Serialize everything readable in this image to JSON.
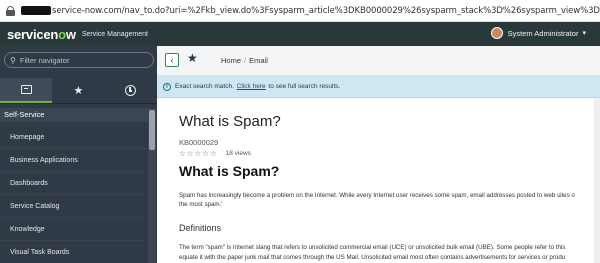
{
  "browser": {
    "url": "service-now.com/nav_to.do?uri=%2Fkb_view.do%3Fsysparm_article%3DKB0000029%26sysparm_stack%3D%26sysparm_view%3D"
  },
  "header": {
    "logo_main": "servicen",
    "logo_o": "o",
    "logo_end": "w",
    "subtitle": "Service Management",
    "user_name": "System Administrator",
    "user_caret": "▾"
  },
  "sidebar": {
    "filter_placeholder": "Filter navigator",
    "section_title": "Self-Service",
    "items": [
      {
        "label": "Homepage"
      },
      {
        "label": "Business Applications"
      },
      {
        "label": "Dashboards"
      },
      {
        "label": "Service Catalog"
      },
      {
        "label": "Knowledge"
      },
      {
        "label": "Visual Task Boards"
      }
    ],
    "tabs": [
      {
        "icon": "all-applications-icon"
      },
      {
        "icon": "favorites-star-icon"
      },
      {
        "icon": "history-clock-icon"
      }
    ]
  },
  "breadcrumbs": {
    "home": "Home",
    "separator": "/",
    "current": "Email"
  },
  "info": {
    "prefix": "Exact search match.",
    "link": "Click here",
    "suffix": "to see full search results."
  },
  "article": {
    "title": "What is Spam?",
    "number": "KB0000029",
    "stars": "☆☆☆☆☆",
    "views": "18 views",
    "heading": "What is Spam?",
    "para1_line1": "Spam has increasingly become a problem on the Internet. While every Internet user receives some spam, email addresses posted to web sites o",
    "para1_line2": "the most spam.'",
    "definitions_heading": "Definitions",
    "para2_line1": "The term \"spam\" is Internet slang that refers to unsolicited commercial email (UCE) or unsolicited bulk email (UBE). Some people refer to this",
    "para2_line2": "equate it with the paper junk mail that comes through the US Mail. Unsolicited email most often contains advertisements for services or produ"
  }
}
